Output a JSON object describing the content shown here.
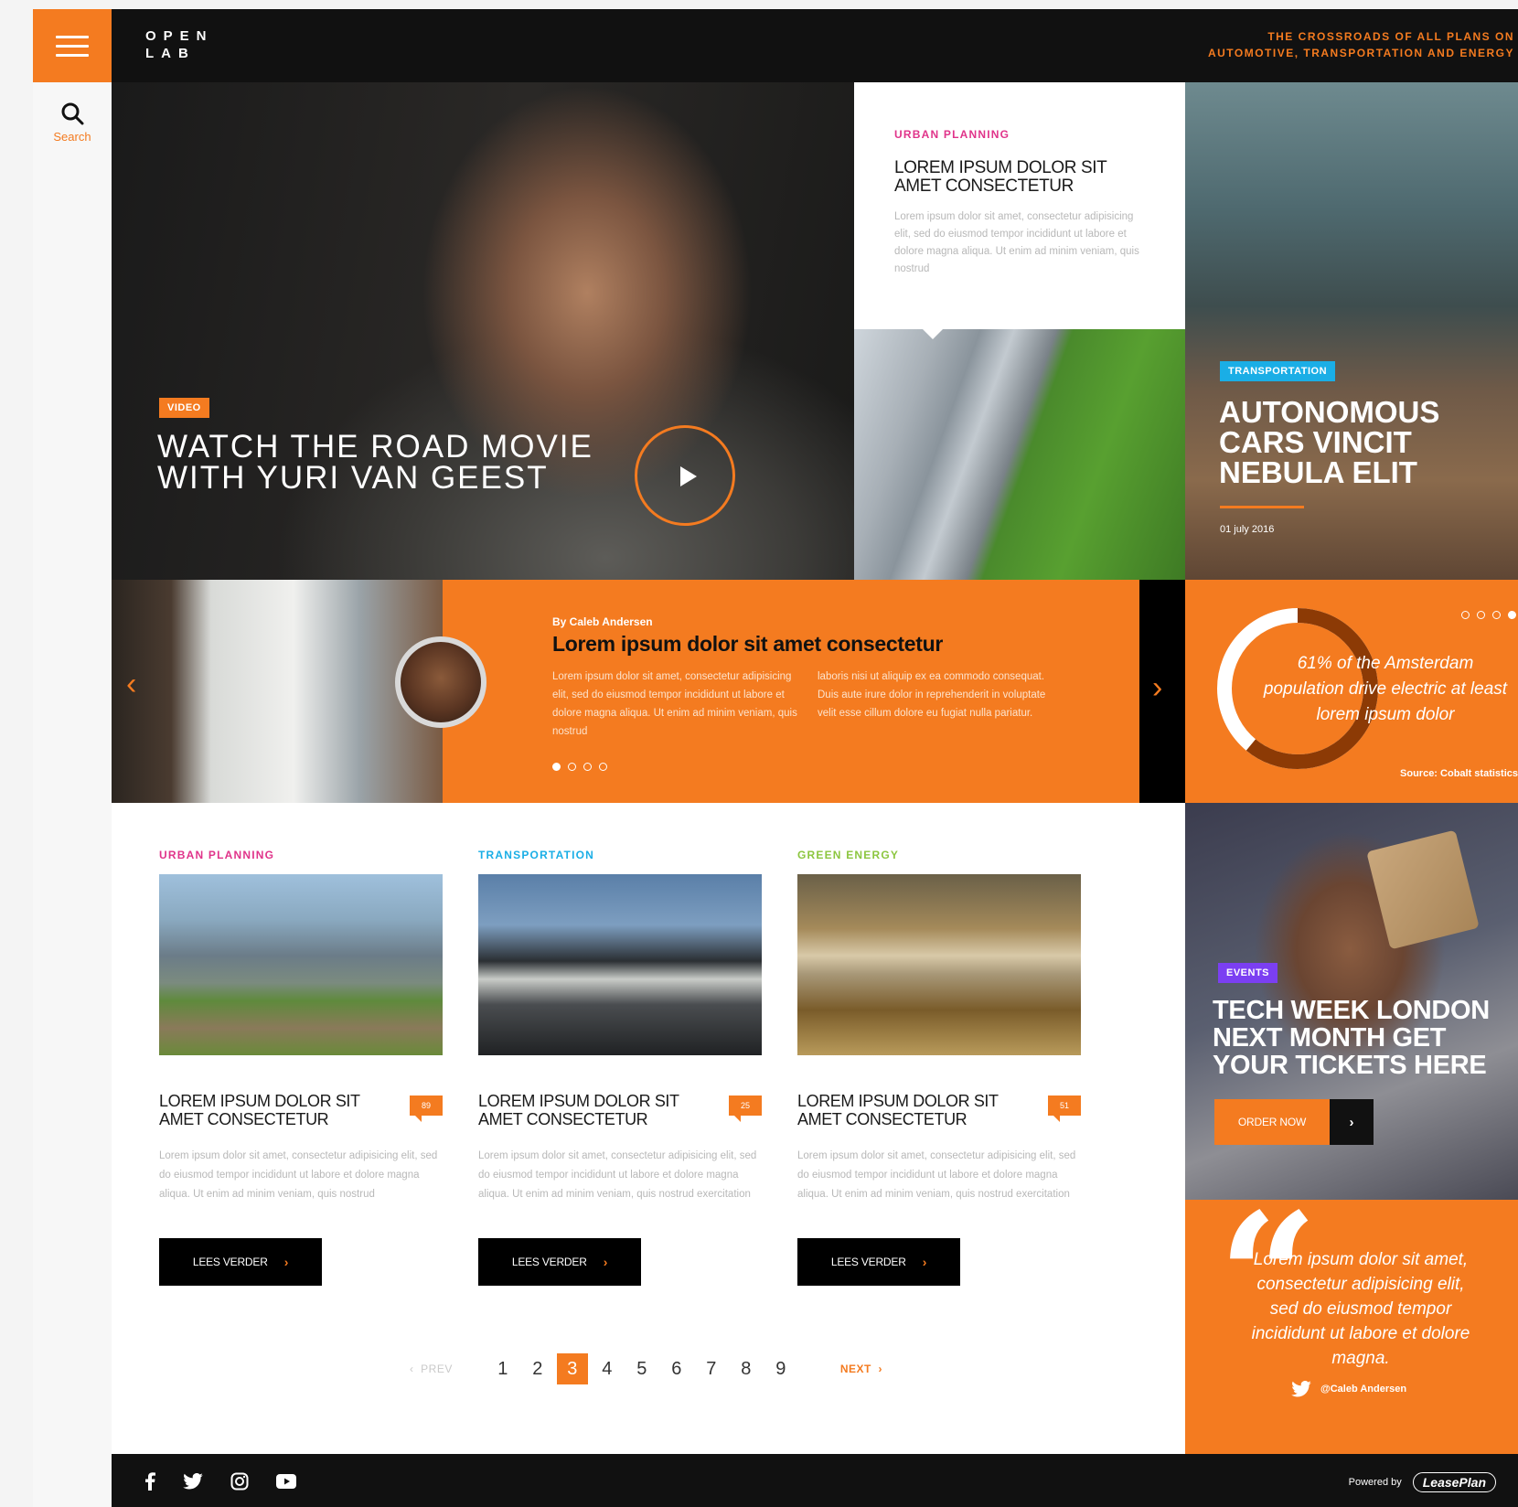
{
  "brand": {
    "logo_line1": "OPEN",
    "logo_line2": "LAB",
    "tagline_line1": "THE CROSSROADS OF ALL PLANS ON",
    "tagline_line2": "AUTOMOTIVE, TRANSPORTATION AND ENERGY"
  },
  "rail": {
    "search_label": "Search"
  },
  "hero": {
    "badge": "VIDEO",
    "title": "WATCH THE ROAD MOVIE WITH YURI VAN GEEST"
  },
  "urban_card": {
    "kicker": "URBAN PLANNING",
    "title": "LOREM IPSUM DOLOR SIT AMET CONSECTETUR",
    "text": "Lorem ipsum dolor sit amet, consectetur adipisicing elit, sed do eiusmod tempor incididunt ut labore et dolore magna aliqua. Ut enim ad minim veniam, quis nostrud"
  },
  "autonomous": {
    "badge": "TRANSPORTATION",
    "title": "AUTONOMOUS CARS VINCIT NEBULA ELIT",
    "date": "01 july 2016"
  },
  "feature": {
    "byline": "By Caleb Andersen",
    "title": "Lorem ipsum dolor sit amet consectetur",
    "col1": "Lorem ipsum dolor sit amet, consectetur adipisicing elit, sed do eiusmod tempor incididunt ut labore et dolore magna aliqua. Ut enim ad minim veniam, quis nostrud",
    "col2": "laboris nisi ut aliquip ex ea commodo consequat. Duis aute irure dolor in reprehenderit in voluptate velit esse cillum dolore eu fugiat nulla pariatur.",
    "prev_icon": "‹",
    "next_icon": "›"
  },
  "stat": {
    "percent": 61,
    "text": "61% of the Amsterdam population drive electric at least lorem ipsum dolor",
    "source": "Source: Cobalt statistics"
  },
  "articles": [
    {
      "kicker": "URBAN PLANNING",
      "kicker_color": "#e0338a",
      "title": "LOREM IPSUM DOLOR SIT AMET CONSECTETUR",
      "comments": "89",
      "text": "Lorem ipsum dolor sit amet, consectetur adipisicing elit, sed do eiusmod tempor incididunt ut labore et dolore magna aliqua. Ut enim ad minim veniam, quis nostrud",
      "button": "LEES VERDER"
    },
    {
      "kicker": "TRANSPORTATION",
      "kicker_color": "#1aaee6",
      "title": "LOREM IPSUM DOLOR SIT AMET CONSECTETUR",
      "comments": "25",
      "text": "Lorem ipsum dolor sit amet, consectetur adipisicing elit, sed do eiusmod tempor incididunt ut labore et dolore magna aliqua. Ut enim ad minim veniam, quis nostrud exercitation",
      "button": "LEES VERDER"
    },
    {
      "kicker": "GREEN ENERGY",
      "kicker_color": "#8cc63f",
      "title": "LOREM IPSUM DOLOR SIT AMET CONSECTETUR",
      "comments": "51",
      "text": "Lorem ipsum dolor sit amet, consectetur adipisicing elit, sed do eiusmod tempor incididunt ut labore et dolore magna aliqua. Ut enim ad minim veniam, quis nostrud exercitation",
      "button": "LEES VERDER"
    }
  ],
  "pagination": {
    "prev": "PREV",
    "next": "NEXT",
    "pages": [
      "1",
      "2",
      "3",
      "4",
      "5",
      "6",
      "7",
      "8",
      "9"
    ],
    "current": "3"
  },
  "events": {
    "badge": "EVENTS",
    "title": "TECH WEEK LONDON NEXT MONTH GET YOUR TICKETS HERE",
    "button": "ORDER NOW"
  },
  "quote": {
    "text": "Lorem ipsum dolor sit amet, consectetur adipisicing elit, sed do eiusmod tempor incididunt ut labore et dolore magna.",
    "author": "@Caleb Andersen"
  },
  "footer": {
    "powered_by": "Powered by",
    "partner": "LeasePlan"
  },
  "colors": {
    "accent": "#f47b20",
    "dark": "#111111",
    "urban": "#e0338a",
    "transport": "#1aaee6",
    "green": "#8cc63f",
    "events": "#7b3ff2"
  },
  "icons": [
    "menu-icon",
    "search-icon",
    "play-icon",
    "chevron-left-icon",
    "chevron-right-icon",
    "quote-icon",
    "twitter-icon",
    "facebook-icon",
    "instagram-icon",
    "youtube-icon"
  ]
}
